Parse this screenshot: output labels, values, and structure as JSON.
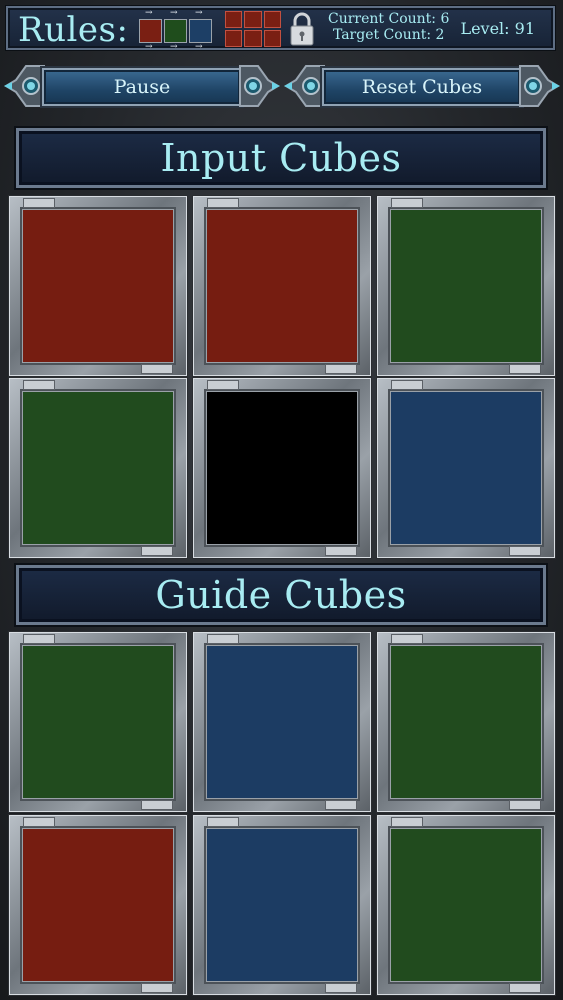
{
  "header": {
    "rules_label": "Rules:",
    "rule_colors": [
      "#7a1f13",
      "#1f4d1c",
      "#1d3f66"
    ],
    "current_count": "Current Count: 6",
    "target_count": "Target Count: 2",
    "level": "Level: 91",
    "lock_icon": "padlock-icon"
  },
  "buttons": {
    "pause": "Pause",
    "reset": "Reset Cubes"
  },
  "sections": {
    "input_title": "Input Cubes",
    "guide_title": "Guide Cubes"
  },
  "colors": {
    "red": "#761d11",
    "green": "#214b1e",
    "blue": "#1c3c63",
    "black": "#000000",
    "title_text": "#a8ecf2"
  },
  "input_cubes": [
    "red",
    "red",
    "green",
    "green",
    "black",
    "blue"
  ],
  "guide_cubes": [
    "green",
    "blue",
    "green",
    "red",
    "blue",
    "green"
  ]
}
